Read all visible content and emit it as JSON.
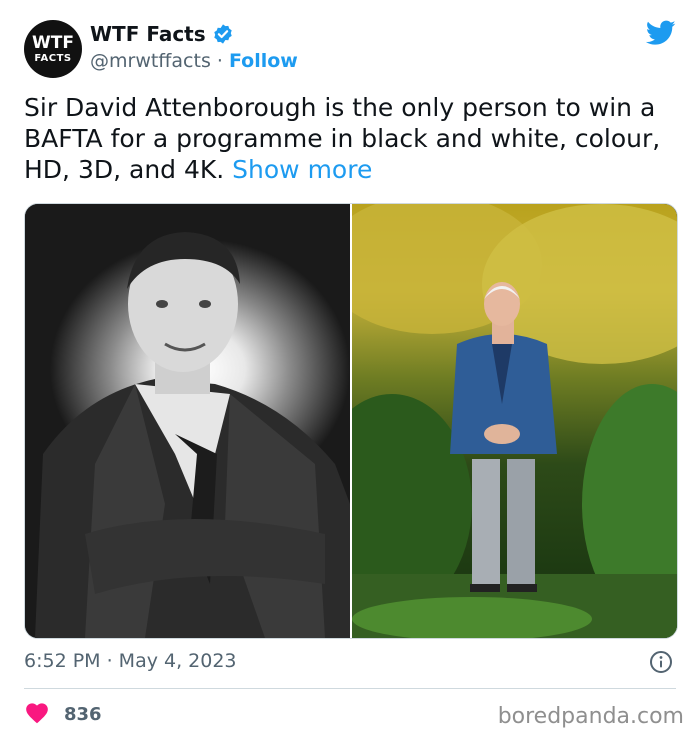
{
  "author": {
    "avatar_line1": "WTF",
    "avatar_line2": "FACTS",
    "name": "WTF Facts",
    "handle": "@mrwtffacts",
    "separator": " · ",
    "follow_label": "Follow"
  },
  "tweet": {
    "text": "Sir David Attenborough is the only person to win a BAFTA for a programme in black and white, colour, HD, 3D, and 4K. ",
    "show_more": "Show more",
    "timestamp": "6:52 PM · May 4, 2023",
    "like_count": "836"
  },
  "media": {
    "left_image": "black-and-white portrait photo",
    "right_image": "colour photo in garden"
  },
  "icons": [
    "verified-badge-icon",
    "twitter-bird-icon",
    "info-icon",
    "heart-icon"
  ],
  "watermark": "boredpanda.com",
  "colors": {
    "accent": "#1d9bf0",
    "heart": "#f91880",
    "text": "#0f1419",
    "muted": "#536471"
  }
}
